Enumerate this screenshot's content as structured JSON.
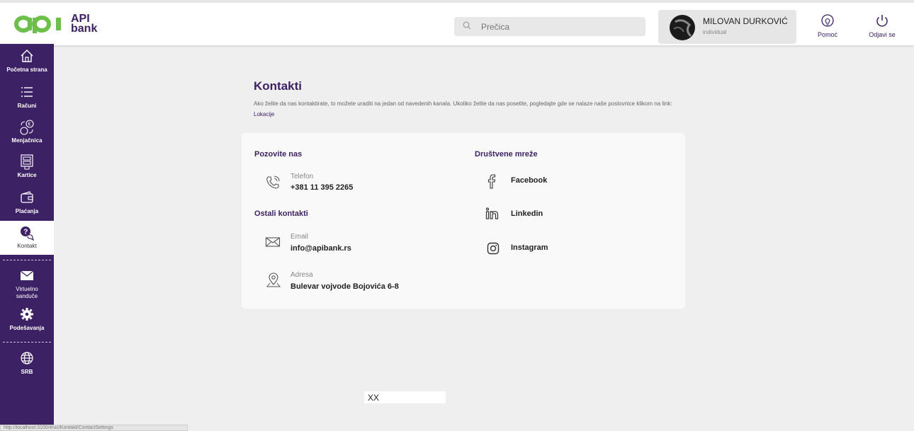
{
  "brand": {
    "logo_text_line1": "API",
    "logo_text_line2": "bank",
    "color_primary": "#3d2165",
    "color_logo": "#6cc04a"
  },
  "header": {
    "search_placeholder": "Prečica",
    "user": {
      "name": "MILOVAN DURKOVIĆ",
      "type": "individual"
    },
    "help_label": "Pomoć",
    "logout_label": "Odjavi se"
  },
  "sidebar": {
    "items": [
      {
        "label": "Početna strana",
        "icon": "home-icon"
      },
      {
        "label": "Računi",
        "icon": "list-icon"
      },
      {
        "label": "Menjačnica",
        "icon": "exchange-icon"
      },
      {
        "label": "Kartice",
        "icon": "card-icon"
      },
      {
        "label": "Plaćanja",
        "icon": "wallet-icon"
      },
      {
        "label": "Kontakt",
        "icon": "chat-icon",
        "active": true
      },
      {
        "label": "Virtuelno sanduče",
        "icon": "mail-icon"
      },
      {
        "label": "Podešavanja",
        "icon": "gear-icon"
      },
      {
        "label": "SRB",
        "icon": "globe-icon"
      }
    ]
  },
  "main": {
    "title": "Kontakti",
    "description": "Ako želite da nas kontaktirate, to možete uraditi na jedan od navedenih kanala. Ukoliko želite da nas posetite, pogledajte gde se nalaze naše poslovnice klikom na link:",
    "location_link": "Lokacije",
    "call_section": {
      "title": "Pozovite nas",
      "phone_label": "Telefon",
      "phone_value": "+381 11 395 2265"
    },
    "other_section": {
      "title": "Ostali kontakti",
      "email_label": "Email",
      "email_value": "info@apibank.rs",
      "address_label": "Adresa",
      "address_value": "Bulevar vojvode Bojovića 6-8"
    },
    "social_section": {
      "title": "Društvene mreže",
      "items": [
        "Facebook",
        "Linkedin",
        "Instagram"
      ]
    }
  },
  "footer_text": "XX",
  "status_url": "http://localhost:3100/#/uc/Kontakt/ContactSettings"
}
